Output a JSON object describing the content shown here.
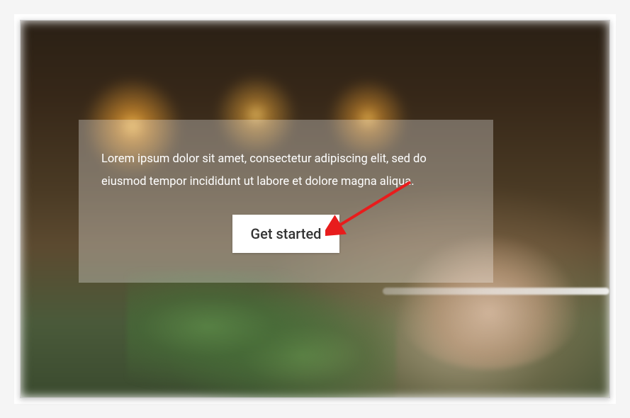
{
  "hero": {
    "paragraph": "Lorem ipsum dolor sit amet, consectetur adipiscing elit, sed do eiusmod tempor incididunt ut labore et dolore magna aliqua.",
    "button_label": "Get started"
  }
}
